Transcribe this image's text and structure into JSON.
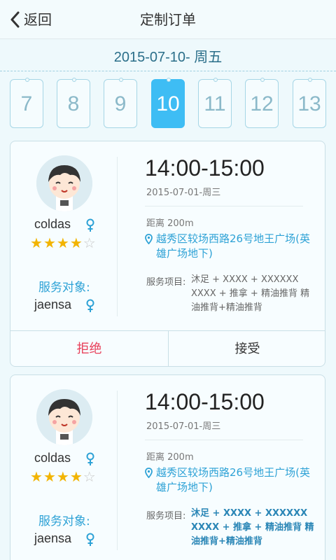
{
  "header": {
    "back_label": "返回",
    "title": "定制订单"
  },
  "date_header": "2015-07-10- 周五",
  "days": [
    "7",
    "8",
    "9",
    "10",
    "11",
    "12",
    "13"
  ],
  "selected_day": "10",
  "colors": {
    "accent": "#3ebdf4",
    "link": "#2ea2d6",
    "reject": "#e8405a",
    "star": "#f2b400"
  },
  "orders": [
    {
      "username": "coldas",
      "rating": 4,
      "rating_max": 5,
      "service_target_label": "服务对象:",
      "target_name": "jaensa",
      "time": "14:00-15:00",
      "date": "2015-07-01-周三",
      "distance": "距离 200m",
      "address": "越秀区较场西路26号地王广场(英雄广场地下)",
      "services_label": "服务项目:",
      "services": "沐足 + XXXX + XXXXXX XXXX + 推拿 + 精油推背 精油推背+精油推背",
      "reject_label": "拒绝",
      "accept_label": "接受"
    },
    {
      "username": "coldas",
      "rating": 4,
      "rating_max": 5,
      "service_target_label": "服务对象:",
      "target_name": "jaensa",
      "time": "14:00-15:00",
      "date": "2015-07-01-周三",
      "distance": "距离 200m",
      "address": "越秀区较场西路26号地王广场(英雄广场地下)",
      "services_label": "服务项目:",
      "services": "沐足 + XXXX + XXXXXX XXXX + 推拿 + 精油推背 精油推背+精油推背"
    }
  ]
}
